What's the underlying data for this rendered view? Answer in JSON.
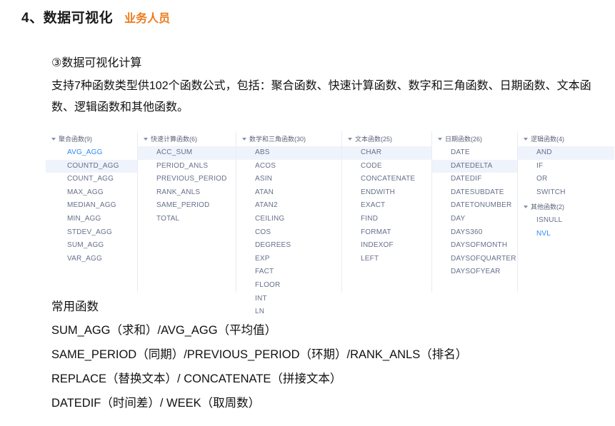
{
  "heading": {
    "title": "4、数据可视化",
    "audience_tag": "业务人员",
    "tag_color": "#EC7B1E"
  },
  "intro": {
    "subtitle": "③数据可视化计算",
    "paragraph": "支持7种函数类型供102个函数公式，包括：聚合函数、快速计算函数、数字和三角函数、日期函数、文本函数、逻辑函数和其他函数。",
    "function_type_count": 7,
    "formula_count": 102
  },
  "function_board": {
    "highlight_color": "#eff3fb",
    "active_color": "#2b8bf2",
    "columns": [
      {
        "groups": [
          {
            "name": "聚合函数",
            "count": 9,
            "header": "聚合函数(9)",
            "functions": [
              {
                "name": "AVG_AGG",
                "state": "active"
              },
              {
                "name": "COUNTD_AGG",
                "state": "selected"
              },
              {
                "name": "COUNT_AGG",
                "state": "normal"
              },
              {
                "name": "MAX_AGG",
                "state": "normal"
              },
              {
                "name": "MEDIAN_AGG",
                "state": "normal"
              },
              {
                "name": "MIN_AGG",
                "state": "normal"
              },
              {
                "name": "STDEV_AGG",
                "state": "normal"
              },
              {
                "name": "SUM_AGG",
                "state": "normal"
              },
              {
                "name": "VAR_AGG",
                "state": "normal"
              }
            ]
          }
        ]
      },
      {
        "groups": [
          {
            "name": "快速计算函数",
            "count": 6,
            "header": "快速计算函数(6)",
            "functions": [
              {
                "name": "ACC_SUM",
                "state": "selected"
              },
              {
                "name": "PERIOD_ANLS",
                "state": "normal"
              },
              {
                "name": "PREVIOUS_PERIOD",
                "state": "normal"
              },
              {
                "name": "RANK_ANLS",
                "state": "normal"
              },
              {
                "name": "SAME_PERIOD",
                "state": "normal"
              },
              {
                "name": "TOTAL",
                "state": "normal"
              }
            ]
          }
        ]
      },
      {
        "groups": [
          {
            "name": "数学和三角函数",
            "count": 30,
            "header": "数学和三角函数(30)",
            "functions": [
              {
                "name": "ABS",
                "state": "selected"
              },
              {
                "name": "ACOS",
                "state": "normal"
              },
              {
                "name": "ASIN",
                "state": "normal"
              },
              {
                "name": "ATAN",
                "state": "normal"
              },
              {
                "name": "ATAN2",
                "state": "normal"
              },
              {
                "name": "CEILING",
                "state": "normal"
              },
              {
                "name": "COS",
                "state": "normal"
              },
              {
                "name": "DEGREES",
                "state": "normal"
              },
              {
                "name": "EXP",
                "state": "normal"
              },
              {
                "name": "FACT",
                "state": "normal"
              },
              {
                "name": "FLOOR",
                "state": "normal"
              },
              {
                "name": "INT",
                "state": "normal"
              },
              {
                "name": "LN",
                "state": "normal"
              }
            ]
          }
        ]
      },
      {
        "groups": [
          {
            "name": "文本函数",
            "count": 25,
            "header": "文本函数(25)",
            "functions": [
              {
                "name": "CHAR",
                "state": "selected"
              },
              {
                "name": "CODE",
                "state": "normal"
              },
              {
                "name": "CONCATENATE",
                "state": "normal"
              },
              {
                "name": "ENDWITH",
                "state": "normal"
              },
              {
                "name": "EXACT",
                "state": "normal"
              },
              {
                "name": "FIND",
                "state": "normal"
              },
              {
                "name": "FORMAT",
                "state": "normal"
              },
              {
                "name": "INDEXOF",
                "state": "normal"
              },
              {
                "name": "LEFT",
                "state": "normal"
              }
            ]
          }
        ]
      },
      {
        "groups": [
          {
            "name": "日期函数",
            "count": 26,
            "header": "日期函数(26)",
            "functions": [
              {
                "name": "DATE",
                "state": "normal"
              },
              {
                "name": "DATEDELTA",
                "state": "selected"
              },
              {
                "name": "DATEDIF",
                "state": "normal"
              },
              {
                "name": "DATESUBDATE",
                "state": "normal"
              },
              {
                "name": "DATETONUMBER",
                "state": "normal"
              },
              {
                "name": "DAY",
                "state": "normal"
              },
              {
                "name": "DAYS360",
                "state": "normal"
              },
              {
                "name": "DAYSOFMONTH",
                "state": "normal"
              },
              {
                "name": "DAYSOFQUARTER",
                "state": "normal"
              },
              {
                "name": "DAYSOFYEAR",
                "state": "normal"
              }
            ]
          }
        ]
      },
      {
        "groups": [
          {
            "name": "逻辑函数",
            "count": 4,
            "header": "逻辑函数(4)",
            "functions": [
              {
                "name": "AND",
                "state": "selected"
              },
              {
                "name": "IF",
                "state": "normal"
              },
              {
                "name": "OR",
                "state": "normal"
              },
              {
                "name": "SWITCH",
                "state": "normal"
              }
            ]
          },
          {
            "name": "其他函数",
            "count": 2,
            "header": "其他函数(2)",
            "functions": [
              {
                "name": "ISNULL",
                "state": "normal"
              },
              {
                "name": "NVL",
                "state": "active"
              }
            ]
          }
        ]
      }
    ]
  },
  "common_functions": {
    "label": "常用函数",
    "lines": [
      "SUM_AGG（求和）/AVG_AGG（平均值）",
      "SAME_PERIOD（同期）/PREVIOUS_PERIOD（环期）/RANK_ANLS（排名）",
      "REPLACE（替换文本）/ CONCATENATE（拼接文本）",
      "DATEDIF（时间差）/ WEEK（取周数）"
    ]
  }
}
